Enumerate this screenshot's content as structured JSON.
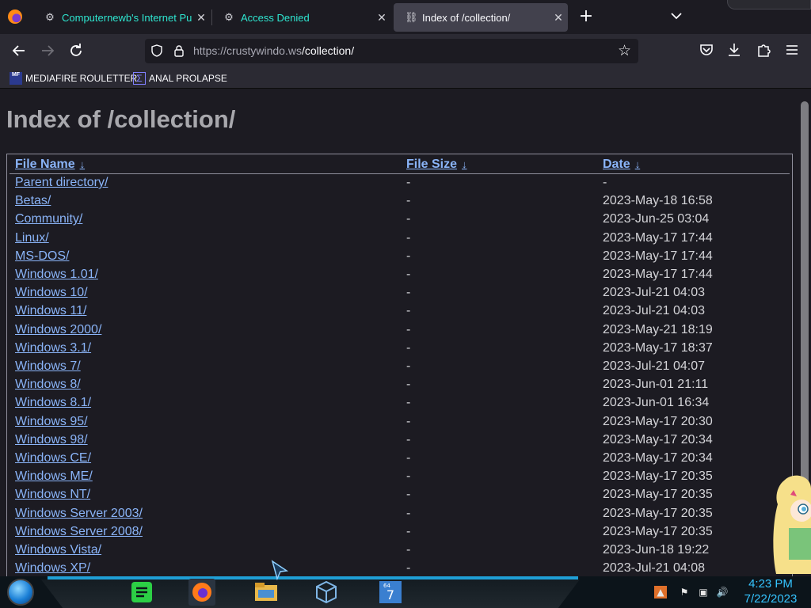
{
  "tabs": [
    {
      "title": "Computernewb's Internet Pub",
      "close": "✕",
      "active": false
    },
    {
      "title": "Access Denied",
      "close": "✕",
      "active": false
    },
    {
      "title": "Index of /collection/",
      "close": "✕",
      "active": true
    }
  ],
  "new_tab": "+",
  "nav": {
    "url_host": "https://crustywindo.ws",
    "url_path": "/collection/"
  },
  "bookmarks": [
    {
      "label": "MEDIAFIRE ROULETTER",
      "icon": "mediafire-icon",
      "icon_text": "MF"
    },
    {
      "label": "ANAL PROLAPSE",
      "icon": "sigma-icon",
      "icon_text": "Σ"
    }
  ],
  "page": {
    "title": "Index of /collection/",
    "columns": {
      "name": "File Name",
      "size": "File Size",
      "date": "Date",
      "sort_arrow": "↓"
    },
    "rows": [
      {
        "name": "Parent directory/",
        "size": "-",
        "date": "-"
      },
      {
        "name": "Betas/",
        "size": "-",
        "date": "2023-May-18 16:58"
      },
      {
        "name": "Community/",
        "size": "-",
        "date": "2023-Jun-25 03:04"
      },
      {
        "name": "Linux/",
        "size": "-",
        "date": "2023-May-17 17:44"
      },
      {
        "name": "MS-DOS/",
        "size": "-",
        "date": "2023-May-17 17:44"
      },
      {
        "name": "Windows 1.01/",
        "size": "-",
        "date": "2023-May-17 17:44"
      },
      {
        "name": "Windows 10/",
        "size": "-",
        "date": "2023-Jul-21 04:03"
      },
      {
        "name": "Windows 11/",
        "size": "-",
        "date": "2023-Jul-21 04:03"
      },
      {
        "name": "Windows 2000/",
        "size": "-",
        "date": "2023-May-21 18:19"
      },
      {
        "name": "Windows 3.1/",
        "size": "-",
        "date": "2023-May-17 18:37"
      },
      {
        "name": "Windows 7/",
        "size": "-",
        "date": "2023-Jul-21 04:07"
      },
      {
        "name": "Windows 8/",
        "size": "-",
        "date": "2023-Jun-01 21:11"
      },
      {
        "name": "Windows 8.1/",
        "size": "-",
        "date": "2023-Jun-01 16:34"
      },
      {
        "name": "Windows 95/",
        "size": "-",
        "date": "2023-May-17 20:30"
      },
      {
        "name": "Windows 98/",
        "size": "-",
        "date": "2023-May-17 20:34"
      },
      {
        "name": "Windows CE/",
        "size": "-",
        "date": "2023-May-17 20:34"
      },
      {
        "name": "Windows ME/",
        "size": "-",
        "date": "2023-May-17 20:35"
      },
      {
        "name": "Windows NT/",
        "size": "-",
        "date": "2023-May-17 20:35"
      },
      {
        "name": "Windows Server 2003/",
        "size": "-",
        "date": "2023-May-17 20:35"
      },
      {
        "name": "Windows Server 2008/",
        "size": "-",
        "date": "2023-May-17 20:35"
      },
      {
        "name": "Windows Vista/",
        "size": "-",
        "date": "2023-Jun-18 19:22"
      },
      {
        "name": "Windows XP/",
        "size": "-",
        "date": "2023-Jul-21 04:08"
      }
    ]
  },
  "taskbar": {
    "time": "4:23 PM",
    "date": "7/22/2023",
    "apps": [
      "notes-app-icon",
      "firefox-icon",
      "file-explorer-icon",
      "virtualbox-icon",
      "win7-64-icon"
    ],
    "tray": [
      "flame-icon",
      "flag-icon",
      "network-icon",
      "volume-icon"
    ]
  },
  "colors": {
    "accent": "#2ee6d0",
    "link": "#8ab4f8",
    "clock": "#35c4ff"
  }
}
